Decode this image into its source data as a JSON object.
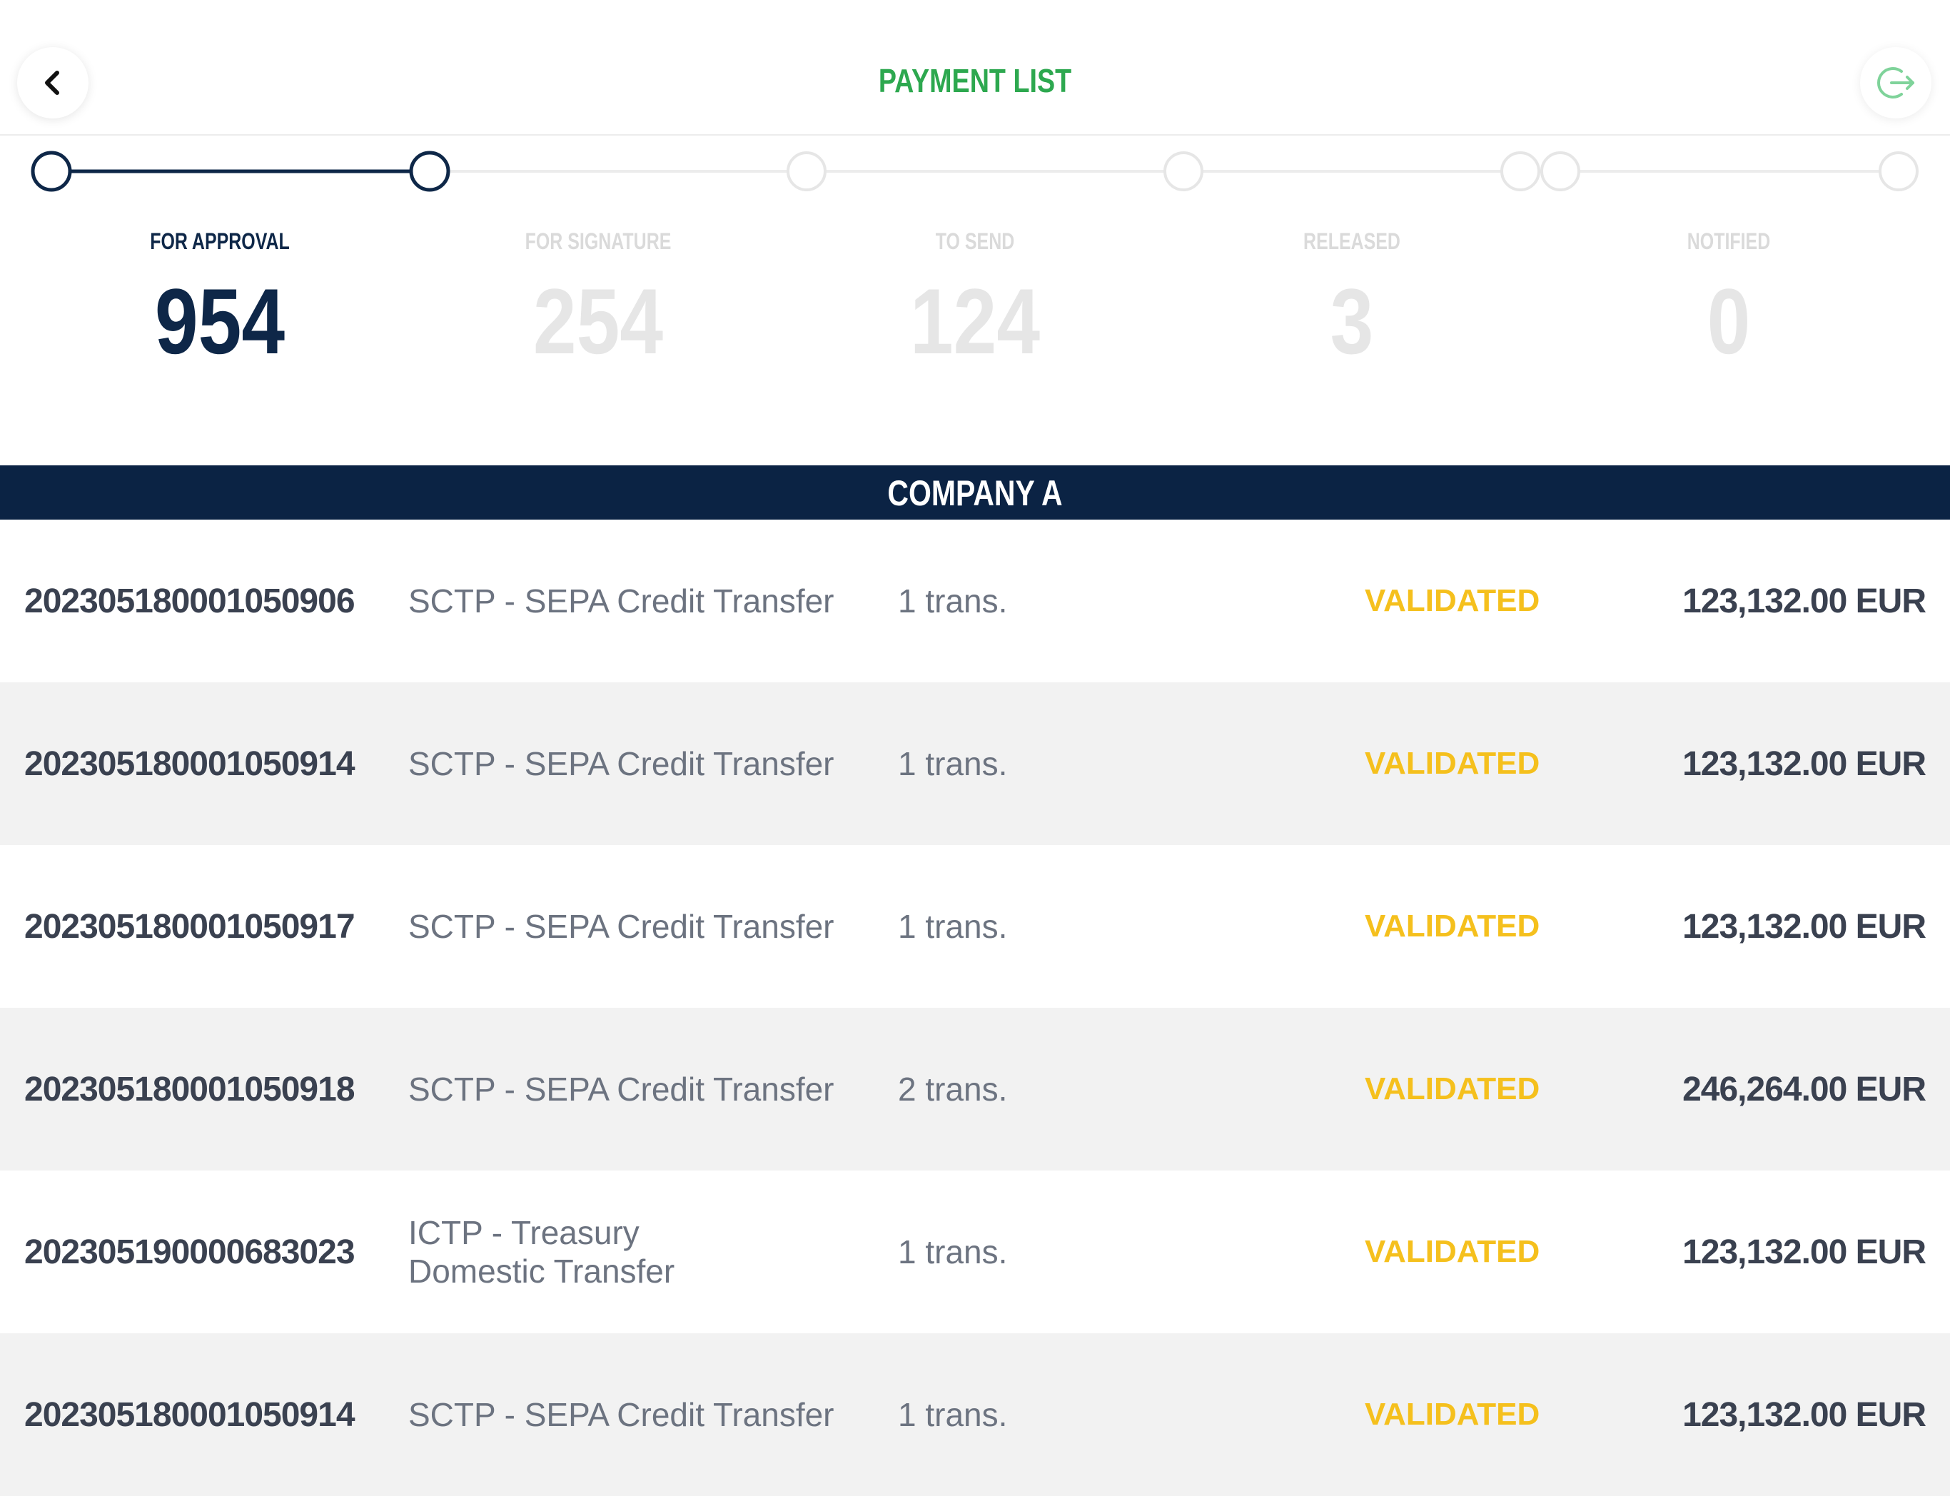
{
  "header": {
    "title": "PAYMENT LIST",
    "back_icon": "chevron-left-icon",
    "logout_icon": "logout-icon"
  },
  "colors": {
    "title_green": "#2da84f",
    "navy": "#0b2344",
    "status_yellow": "#f5c01d",
    "inactive_gray": "#dadada"
  },
  "stats": [
    {
      "label": "FOR APPROVAL",
      "value": "954",
      "active": true
    },
    {
      "label": "FOR SIGNATURE",
      "value": "254",
      "active": false
    },
    {
      "label": "TO SEND",
      "value": "124",
      "active": false
    },
    {
      "label": "RELEASED",
      "value": "3",
      "active": false
    },
    {
      "label": "NOTIFIED",
      "value": "0",
      "active": false
    }
  ],
  "company": {
    "name": "COMPANY A"
  },
  "payments": [
    {
      "id": "202305180001050906",
      "type": "SCTP - SEPA Credit Transfer",
      "trans": "1 trans.",
      "status": "VALIDATED",
      "amount": "123,132.00 EUR"
    },
    {
      "id": "202305180001050914",
      "type": "SCTP - SEPA Credit Transfer",
      "trans": "1 trans.",
      "status": "VALIDATED",
      "amount": "123,132.00 EUR"
    },
    {
      "id": "202305180001050917",
      "type": "SCTP - SEPA Credit Transfer",
      "trans": "1 trans.",
      "status": "VALIDATED",
      "amount": "123,132.00 EUR"
    },
    {
      "id": "202305180001050918",
      "type": "SCTP - SEPA Credit Transfer",
      "trans": "2 trans.",
      "status": "VALIDATED",
      "amount": "246,264.00 EUR"
    },
    {
      "id": "202305190000683023",
      "type": "ICTP - Treasury Domestic Transfer",
      "trans": "1 trans.",
      "status": "VALIDATED",
      "amount": "123,132.00 EUR"
    },
    {
      "id": "202305180001050914",
      "type": "SCTP - SEPA Credit Transfer",
      "trans": "1 trans.",
      "status": "VALIDATED",
      "amount": "123,132.00 EUR"
    }
  ]
}
